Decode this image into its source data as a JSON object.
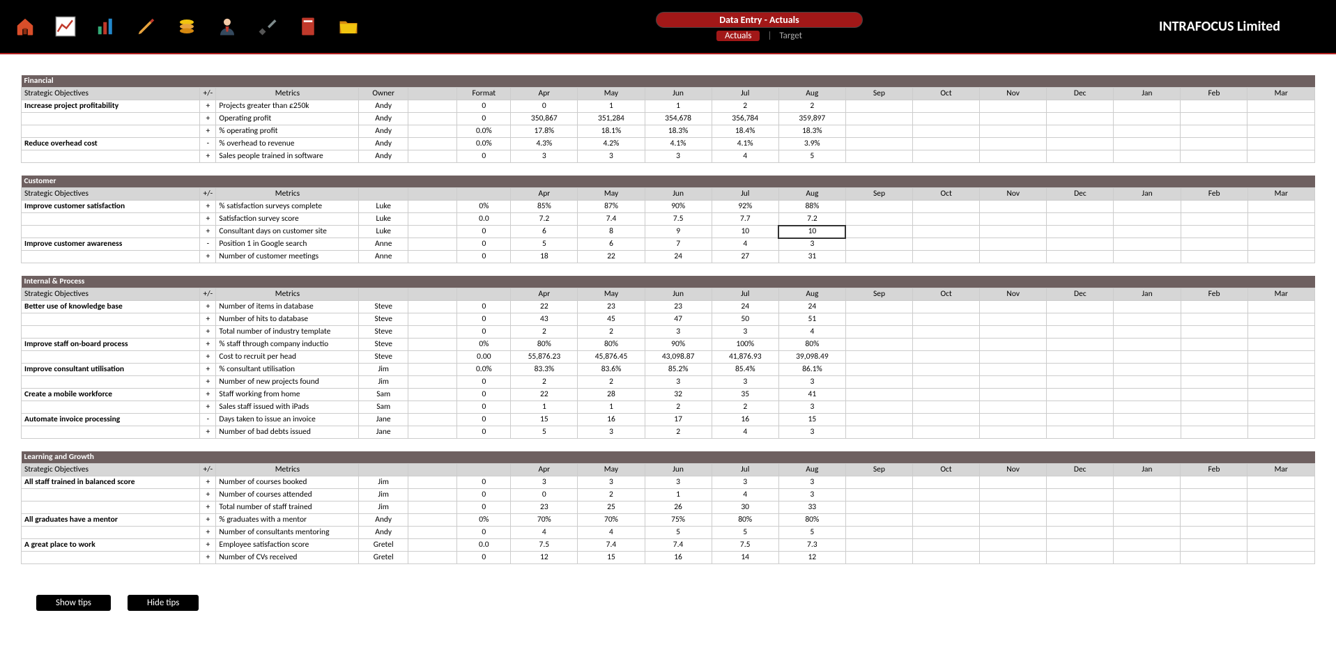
{
  "header": {
    "title": "Data Entry - Actuals",
    "tab_active": "Actuals",
    "tab_inactive": "Target",
    "brand": "INTRAFOCUS Limited"
  },
  "columns": {
    "objectives": "Strategic Objectives",
    "pm": "+/-",
    "metrics": "Metrics",
    "owner": "Owner",
    "format": "Format",
    "months": [
      "Apr",
      "May",
      "Jun",
      "Jul",
      "Aug",
      "Sep",
      "Oct",
      "Nov",
      "Dec",
      "Jan",
      "Feb",
      "Mar"
    ]
  },
  "sections": [
    {
      "name": "Financial",
      "show_owner": true,
      "show_format": true,
      "rows": [
        {
          "obj": "Increase project profitability",
          "pm": "+",
          "metric": "Projects greater than £250k",
          "owner": "Andy",
          "format": "0",
          "vals": [
            "0",
            "1",
            "1",
            "2",
            "2",
            "",
            "",
            "",
            "",
            "",
            "",
            ""
          ]
        },
        {
          "obj": "",
          "pm": "+",
          "metric": "Operating profit",
          "owner": "Andy",
          "format": "0",
          "vals": [
            "350,867",
            "351,284",
            "354,678",
            "356,784",
            "359,897",
            "",
            "",
            "",
            "",
            "",
            "",
            ""
          ]
        },
        {
          "obj": "",
          "pm": "+",
          "metric": "% operating profit",
          "owner": "Andy",
          "format": "0.0%",
          "vals": [
            "17.8%",
            "18.1%",
            "18.3%",
            "18.4%",
            "18.3%",
            "",
            "",
            "",
            "",
            "",
            "",
            ""
          ]
        },
        {
          "obj": "Reduce overhead cost",
          "pm": "-",
          "metric": "% overhead to revenue",
          "owner": "Andy",
          "format": "0.0%",
          "vals": [
            "4.3%",
            "4.2%",
            "4.1%",
            "4.1%",
            "3.9%",
            "",
            "",
            "",
            "",
            "",
            "",
            ""
          ]
        },
        {
          "obj": "",
          "pm": "+",
          "metric": "Sales people trained in software",
          "owner": "Andy",
          "format": "0",
          "vals": [
            "3",
            "3",
            "3",
            "4",
            "5",
            "",
            "",
            "",
            "",
            "",
            "",
            ""
          ]
        }
      ]
    },
    {
      "name": "Customer",
      "show_owner": false,
      "show_format": false,
      "rows": [
        {
          "obj": "Improve customer satisfaction",
          "pm": "+",
          "metric": "% satisfaction surveys complete",
          "owner": "Luke",
          "format": "0%",
          "vals": [
            "85%",
            "87%",
            "90%",
            "92%",
            "88%",
            "",
            "",
            "",
            "",
            "",
            "",
            ""
          ]
        },
        {
          "obj": "",
          "pm": "+",
          "metric": "Satisfaction survey score",
          "owner": "Luke",
          "format": "0.0",
          "vals": [
            "7.2",
            "7.4",
            "7.5",
            "7.7",
            "7.2",
            "",
            "",
            "",
            "",
            "",
            "",
            ""
          ]
        },
        {
          "obj": "",
          "pm": "+",
          "metric": "Consultant days on customer site",
          "owner": "Luke",
          "format": "0",
          "vals": [
            "6",
            "8",
            "9",
            "10",
            "10",
            "",
            "",
            "",
            "",
            "",
            "",
            ""
          ],
          "selected": 4
        },
        {
          "obj": "Improve customer awareness",
          "pm": "-",
          "metric": "Position 1 in Google search",
          "owner": "Anne",
          "format": "0",
          "vals": [
            "5",
            "6",
            "7",
            "4",
            "3",
            "",
            "",
            "",
            "",
            "",
            "",
            ""
          ]
        },
        {
          "obj": "",
          "pm": "+",
          "metric": "Number of customer meetings",
          "owner": "Anne",
          "format": "0",
          "vals": [
            "18",
            "22",
            "24",
            "27",
            "31",
            "",
            "",
            "",
            "",
            "",
            "",
            ""
          ]
        }
      ]
    },
    {
      "name": "Internal & Process",
      "show_owner": false,
      "show_format": false,
      "rows": [
        {
          "obj": "Better use of knowledge base",
          "pm": "+",
          "metric": "Number of items in database",
          "owner": "Steve",
          "format": "0",
          "vals": [
            "22",
            "23",
            "23",
            "24",
            "24",
            "",
            "",
            "",
            "",
            "",
            "",
            ""
          ]
        },
        {
          "obj": "",
          "pm": "+",
          "metric": "Number of hits to database",
          "owner": "Steve",
          "format": "0",
          "vals": [
            "43",
            "45",
            "47",
            "50",
            "51",
            "",
            "",
            "",
            "",
            "",
            "",
            ""
          ]
        },
        {
          "obj": "",
          "pm": "+",
          "metric": "Total number of industry template",
          "owner": "Steve",
          "format": "0",
          "vals": [
            "2",
            "2",
            "3",
            "3",
            "4",
            "",
            "",
            "",
            "",
            "",
            "",
            ""
          ]
        },
        {
          "obj": "Improve staff on-board process",
          "pm": "+",
          "metric": "% staff through company inductio",
          "owner": "Steve",
          "format": "0%",
          "vals": [
            "80%",
            "80%",
            "90%",
            "100%",
            "80%",
            "",
            "",
            "",
            "",
            "",
            "",
            ""
          ]
        },
        {
          "obj": "",
          "pm": "+",
          "metric": "Cost to recruit per head",
          "owner": "Steve",
          "format": "0.00",
          "vals": [
            "55,876.23",
            "45,876.45",
            "43,098.87",
            "41,876.93",
            "39,098.49",
            "",
            "",
            "",
            "",
            "",
            "",
            ""
          ]
        },
        {
          "obj": "Improve consultant utilisation",
          "pm": "+",
          "metric": "% consultant utilisation",
          "owner": "Jim",
          "format": "0.0%",
          "vals": [
            "83.3%",
            "83.6%",
            "85.2%",
            "85.4%",
            "86.1%",
            "",
            "",
            "",
            "",
            "",
            "",
            ""
          ]
        },
        {
          "obj": "",
          "pm": "+",
          "metric": "Number of new projects found",
          "owner": "Jim",
          "format": "0",
          "vals": [
            "2",
            "2",
            "3",
            "3",
            "3",
            "",
            "",
            "",
            "",
            "",
            "",
            ""
          ]
        },
        {
          "obj": "Create a mobile workforce",
          "pm": "+",
          "metric": "Staff working from home",
          "owner": "Sam",
          "format": "0",
          "vals": [
            "22",
            "28",
            "32",
            "35",
            "41",
            "",
            "",
            "",
            "",
            "",
            "",
            ""
          ]
        },
        {
          "obj": "",
          "pm": "+",
          "metric": "Sales staff issued with iPads",
          "owner": "Sam",
          "format": "0",
          "vals": [
            "1",
            "1",
            "2",
            "2",
            "3",
            "",
            "",
            "",
            "",
            "",
            "",
            ""
          ]
        },
        {
          "obj": "Automate invoice processing",
          "pm": "-",
          "metric": "Days taken to issue an invoice",
          "owner": "Jane",
          "format": "0",
          "vals": [
            "15",
            "16",
            "17",
            "16",
            "15",
            "",
            "",
            "",
            "",
            "",
            "",
            ""
          ]
        },
        {
          "obj": "",
          "pm": "+",
          "metric": "Number of bad debts issued",
          "owner": "Jane",
          "format": "0",
          "vals": [
            "5",
            "3",
            "2",
            "4",
            "3",
            "",
            "",
            "",
            "",
            "",
            "",
            ""
          ]
        }
      ]
    },
    {
      "name": "Learning and Growth",
      "show_owner": false,
      "show_format": false,
      "rows": [
        {
          "obj": "All staff trained in balanced score",
          "pm": "+",
          "metric": "Number of courses booked",
          "owner": "Jim",
          "format": "0",
          "vals": [
            "3",
            "3",
            "3",
            "3",
            "3",
            "",
            "",
            "",
            "",
            "",
            "",
            ""
          ]
        },
        {
          "obj": "",
          "pm": "+",
          "metric": "Number of courses attended",
          "owner": "Jim",
          "format": "0",
          "vals": [
            "0",
            "2",
            "1",
            "4",
            "3",
            "",
            "",
            "",
            "",
            "",
            "",
            ""
          ]
        },
        {
          "obj": "",
          "pm": "+",
          "metric": "Total number of staff trained",
          "owner": "Jim",
          "format": "0",
          "vals": [
            "23",
            "25",
            "26",
            "30",
            "33",
            "",
            "",
            "",
            "",
            "",
            "",
            ""
          ]
        },
        {
          "obj": "All graduates have a mentor",
          "pm": "+",
          "metric": "% graduates with a mentor",
          "owner": "Andy",
          "format": "0%",
          "vals": [
            "70%",
            "70%",
            "75%",
            "80%",
            "80%",
            "",
            "",
            "",
            "",
            "",
            "",
            ""
          ]
        },
        {
          "obj": "",
          "pm": "+",
          "metric": "Number of consultants mentoring",
          "owner": "Andy",
          "format": "0",
          "vals": [
            "4",
            "4",
            "5",
            "5",
            "5",
            "",
            "",
            "",
            "",
            "",
            "",
            ""
          ]
        },
        {
          "obj": "A great place to work",
          "pm": "+",
          "metric": "Employee satisfaction score",
          "owner": "Gretel",
          "format": "0.0",
          "vals": [
            "7.5",
            "7.4",
            "7.4",
            "7.5",
            "7.3",
            "",
            "",
            "",
            "",
            "",
            "",
            ""
          ]
        },
        {
          "obj": "",
          "pm": "+",
          "metric": "Number of CVs received",
          "owner": "Gretel",
          "format": "0",
          "vals": [
            "12",
            "15",
            "16",
            "14",
            "12",
            "",
            "",
            "",
            "",
            "",
            "",
            ""
          ]
        }
      ]
    }
  ],
  "footer": {
    "show_tips": "Show tips",
    "hide_tips": "Hide tips"
  }
}
